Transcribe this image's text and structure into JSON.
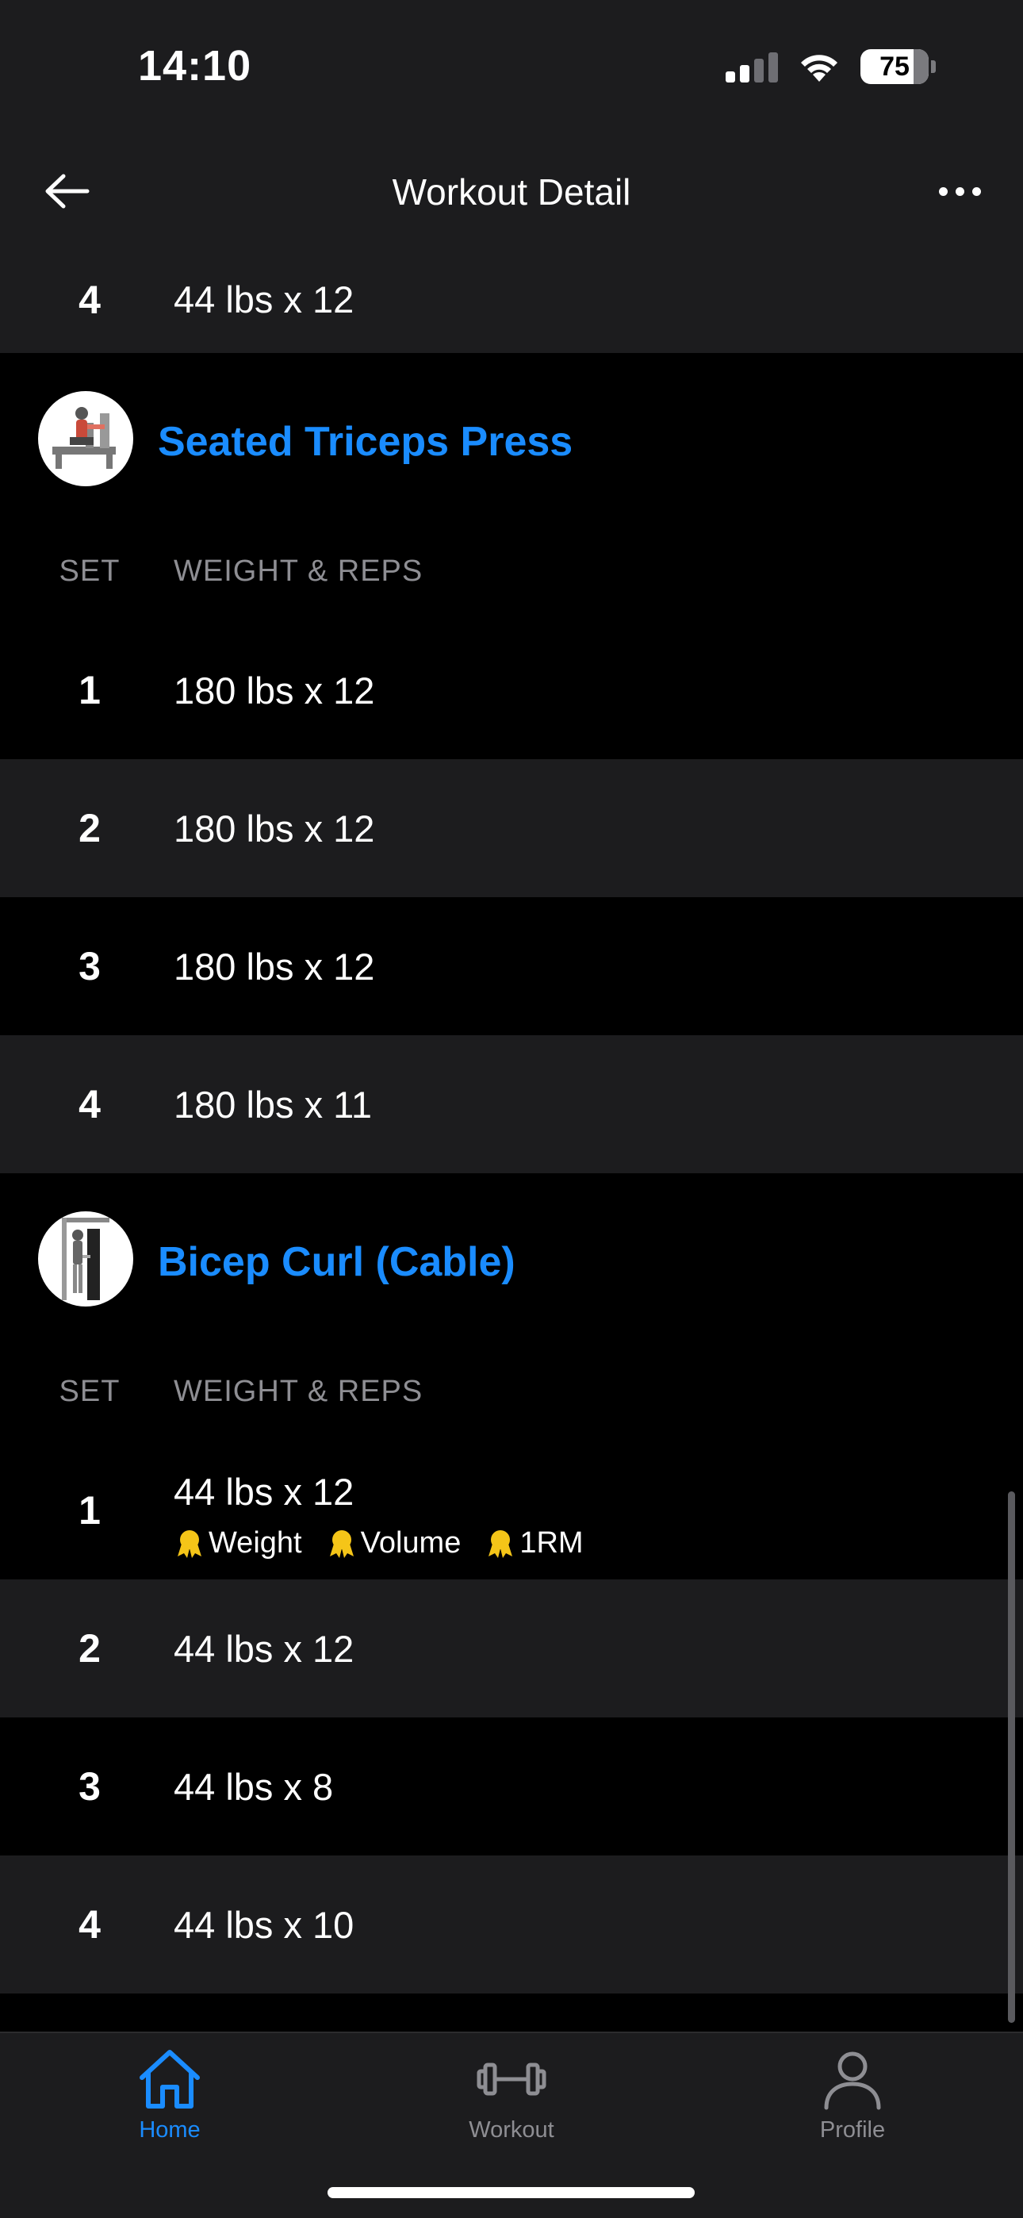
{
  "status_bar": {
    "time": "14:10",
    "battery": "75"
  },
  "nav": {
    "title": "Workout Detail"
  },
  "top_partial_row": {
    "set": "4",
    "reps": "44 lbs x 12"
  },
  "exercises": [
    {
      "name": "Seated Triceps Press",
      "col_set": "SET",
      "col_weight_reps": "WEIGHT & REPS",
      "sets": [
        {
          "set": "1",
          "reps": "180 lbs x 12"
        },
        {
          "set": "2",
          "reps": "180 lbs x 12"
        },
        {
          "set": "3",
          "reps": "180 lbs x 12"
        },
        {
          "set": "4",
          "reps": "180 lbs x 11"
        }
      ]
    },
    {
      "name": "Bicep Curl (Cable)",
      "col_set": "SET",
      "col_weight_reps": "WEIGHT & REPS",
      "sets": [
        {
          "set": "1",
          "reps": "44 lbs x 12",
          "prs": [
            "Weight",
            "Volume",
            "1RM"
          ]
        },
        {
          "set": "2",
          "reps": "44 lbs x 12"
        },
        {
          "set": "3",
          "reps": "44 lbs x 8"
        },
        {
          "set": "4",
          "reps": "44 lbs x 10"
        }
      ]
    }
  ],
  "tabs": [
    {
      "label": "Home",
      "icon": "home-icon",
      "active": true
    },
    {
      "label": "Workout",
      "icon": "dumbbell-icon",
      "active": false
    },
    {
      "label": "Profile",
      "icon": "profile-icon",
      "active": false
    }
  ],
  "colors": {
    "accent": "#1a8cff",
    "background": "#000000",
    "surface": "#1c1c1e",
    "pr_medal": "#f5c518"
  }
}
